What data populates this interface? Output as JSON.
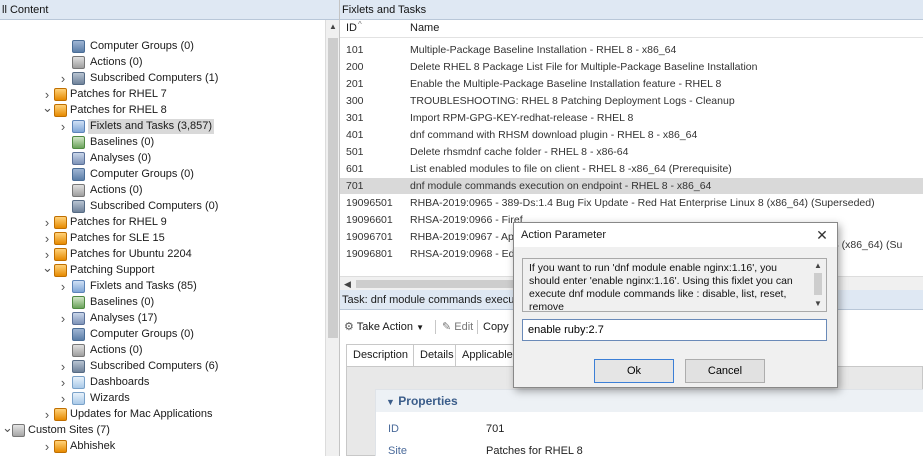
{
  "left_pane": {
    "header": "ll Content",
    "items": [
      {
        "label": "Computer Groups (0)",
        "icon": "computer-groups-icon"
      },
      {
        "label": "Actions (0)",
        "icon": "actions-icon"
      },
      {
        "label": "Subscribed Computers (1)",
        "icon": "subscribed-computers-icon"
      },
      {
        "label": "Patches for RHEL 7",
        "icon": "site-icon"
      },
      {
        "label": "Patches for RHEL 8",
        "icon": "site-icon"
      },
      {
        "label": "Fixlets and Tasks (3,857)",
        "icon": "fixlets-icon"
      },
      {
        "label": "Baselines (0)",
        "icon": "baselines-icon"
      },
      {
        "label": "Analyses (0)",
        "icon": "analyses-icon"
      },
      {
        "label": "Computer Groups (0)",
        "icon": "computer-groups-icon"
      },
      {
        "label": "Actions (0)",
        "icon": "actions-icon"
      },
      {
        "label": "Subscribed Computers (0)",
        "icon": "subscribed-computers-icon"
      },
      {
        "label": "Patches for RHEL 9",
        "icon": "site-icon"
      },
      {
        "label": "Patches for SLE 15",
        "icon": "site-icon"
      },
      {
        "label": "Patches for Ubuntu 2204",
        "icon": "site-icon"
      },
      {
        "label": "Patching Support",
        "icon": "site-icon"
      },
      {
        "label": "Fixlets and Tasks (85)",
        "icon": "fixlets-icon"
      },
      {
        "label": "Baselines (0)",
        "icon": "baselines-icon"
      },
      {
        "label": "Analyses (17)",
        "icon": "analyses-icon"
      },
      {
        "label": "Computer Groups (0)",
        "icon": "computer-groups-icon"
      },
      {
        "label": "Actions (0)",
        "icon": "actions-icon"
      },
      {
        "label": "Subscribed Computers (6)",
        "icon": "subscribed-computers-icon"
      },
      {
        "label": "Dashboards",
        "icon": "folder-icon"
      },
      {
        "label": "Wizards",
        "icon": "folder-icon"
      },
      {
        "label": "Updates for Mac Applications",
        "icon": "site-icon"
      },
      {
        "label": "Custom Sites (7)",
        "icon": "custom-sites-icon"
      },
      {
        "label": "Abhishek",
        "icon": "site-icon"
      }
    ]
  },
  "fixlets": {
    "header": "Fixlets and Tasks",
    "col_id": "ID",
    "col_name": "Name",
    "rows": [
      {
        "id": "101",
        "name": "Multiple-Package Baseline Installation - RHEL 8 - x86_64"
      },
      {
        "id": "200",
        "name": "Delete RHEL 8 Package List File for Multiple-Package Baseline Installation"
      },
      {
        "id": "201",
        "name": "Enable the Multiple-Package Baseline Installation feature - RHEL 8"
      },
      {
        "id": "300",
        "name": "TROUBLESHOOTING: RHEL 8 Patching Deployment Logs - Cleanup"
      },
      {
        "id": "301",
        "name": "Import RPM-GPG-KEY-redhat-release - RHEL 8"
      },
      {
        "id": "401",
        "name": "dnf command with RHSM download plugin - RHEL 8 - x86_64"
      },
      {
        "id": "501",
        "name": "Delete rhsmdnf cache folder - RHEL 8 - x86-64"
      },
      {
        "id": "601",
        "name": "List enabled modules to file on client - RHEL 8 -x86_64 (Prerequisite)"
      },
      {
        "id": "701",
        "name": "dnf module commands execution on endpoint - RHEL 8 - x86_64"
      },
      {
        "id": "19096501",
        "name": "RHBA-2019:0965 - 389-Ds:1.4 Bug Fix Update - Red Hat Enterprise Linux 8 (x86_64) (Superseded)"
      },
      {
        "id": "19096601",
        "name": "RHSA-2019:0966 - Firef"
      },
      {
        "id": "19096701",
        "name": "RHBA-2019:0967 - App"
      },
      {
        "id": "19096801",
        "name": "RHSA-2019:0968 - Edk2"
      }
    ],
    "row_19096701_tail": "nux 8 (x86_64) (Su"
  },
  "task": {
    "header": "Task: dnf module commands executi",
    "toolbar": {
      "take_action": "Take Action",
      "edit": "Edit",
      "copy": "Copy"
    },
    "tabs": [
      "Description",
      "Details",
      "Applicable C"
    ],
    "properties_title": "Properties",
    "props": [
      {
        "key": "ID",
        "value": "701"
      },
      {
        "key": "Site",
        "value": "Patches for RHEL 8"
      }
    ]
  },
  "dialog": {
    "title": "Action Parameter",
    "message": "If you want to run 'dnf module enable nginx:1.16', you should enter 'enable nginx:1.16'. Using this fixlet you can execute dnf module commands like : disable, list, reset, remove",
    "input_value": "enable ruby:2.7",
    "ok_label": "Ok",
    "cancel_label": "Cancel"
  }
}
